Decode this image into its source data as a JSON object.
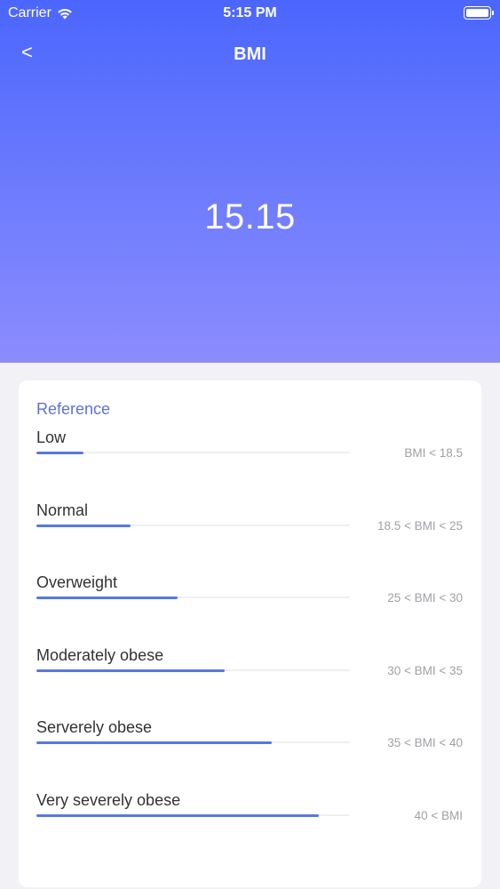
{
  "status_bar": {
    "carrier": "Carrier",
    "time": "5:15 PM",
    "icons": [
      "wifi-icon",
      "battery-icon"
    ]
  },
  "nav": {
    "back_label": "<",
    "title": "BMI"
  },
  "bmi_value": "15.15",
  "reference": {
    "title": "Reference",
    "accent_color": "#5b74dc",
    "items": [
      {
        "label": "Low",
        "range": "BMI < 18.5",
        "level": 0.15
      },
      {
        "label": "Normal",
        "range": "18.5 < BMI < 25",
        "level": 0.3
      },
      {
        "label": "Overweight",
        "range": "25 < BMI < 30",
        "level": 0.45
      },
      {
        "label": "Moderately obese",
        "range": "30 < BMI < 35",
        "level": 0.6
      },
      {
        "label": "Serverely obese",
        "range": "35 < BMI < 40",
        "level": 0.75
      },
      {
        "label": "Very severely obese",
        "range": "40 < BMI",
        "level": 0.9
      }
    ]
  },
  "colors": {
    "header_gradient_top": "#4b66fd",
    "header_gradient_bottom": "#8b8cfd",
    "bar_fill": "#5878e2"
  }
}
